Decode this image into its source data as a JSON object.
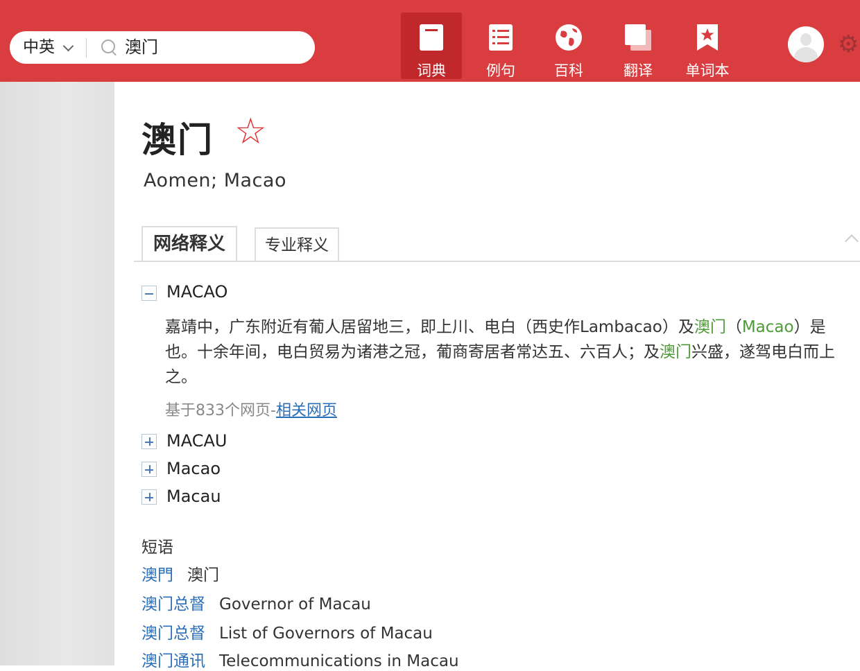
{
  "search": {
    "language": "中英",
    "query": "澳门"
  },
  "nav": {
    "items": [
      {
        "label": "词典",
        "icon": "book-icon",
        "active": true
      },
      {
        "label": "例句",
        "icon": "list-icon",
        "active": false
      },
      {
        "label": "百科",
        "icon": "globe-icon",
        "active": false
      },
      {
        "label": "翻译",
        "icon": "translate-icon",
        "active": false
      },
      {
        "label": "单词本",
        "icon": "bookmark-icon",
        "active": false
      }
    ]
  },
  "header": {
    "avatar": "avatar-icon",
    "settings": "gear-icon"
  },
  "entry": {
    "headword": "澳门",
    "star": "☆",
    "translation": "Aomen; Macao"
  },
  "tabs": [
    "网络释义",
    "专业释义"
  ],
  "web_definitions": [
    {
      "term": "MACAO",
      "expanded": true,
      "text_parts": [
        "嘉靖中，广东附近有葡人居留地三，即上川、电白（西史作Lambacao）及",
        "澳门",
        "（",
        "Macao",
        "）是也。十余年间，电白贸易为诸港之冠，葡商寄居者常达五、六百人；及",
        "澳门",
        "兴盛，遂驾电白而上之。"
      ],
      "source": "基于833个网页-",
      "source_link": "相关网页"
    },
    {
      "term": "MACAU",
      "expanded": false
    },
    {
      "term": "Macao",
      "expanded": false
    },
    {
      "term": "Macau",
      "expanded": false
    }
  ],
  "phrases": {
    "title": "短语",
    "items": [
      {
        "zh": "澳門",
        "en": "澳门"
      },
      {
        "zh": "澳门总督",
        "en": "Governor of Macau"
      },
      {
        "zh": "澳门总督",
        "en": "List of Governors of Macau"
      },
      {
        "zh": "澳门通讯",
        "en": "Telecommunications in Macau"
      }
    ]
  }
}
